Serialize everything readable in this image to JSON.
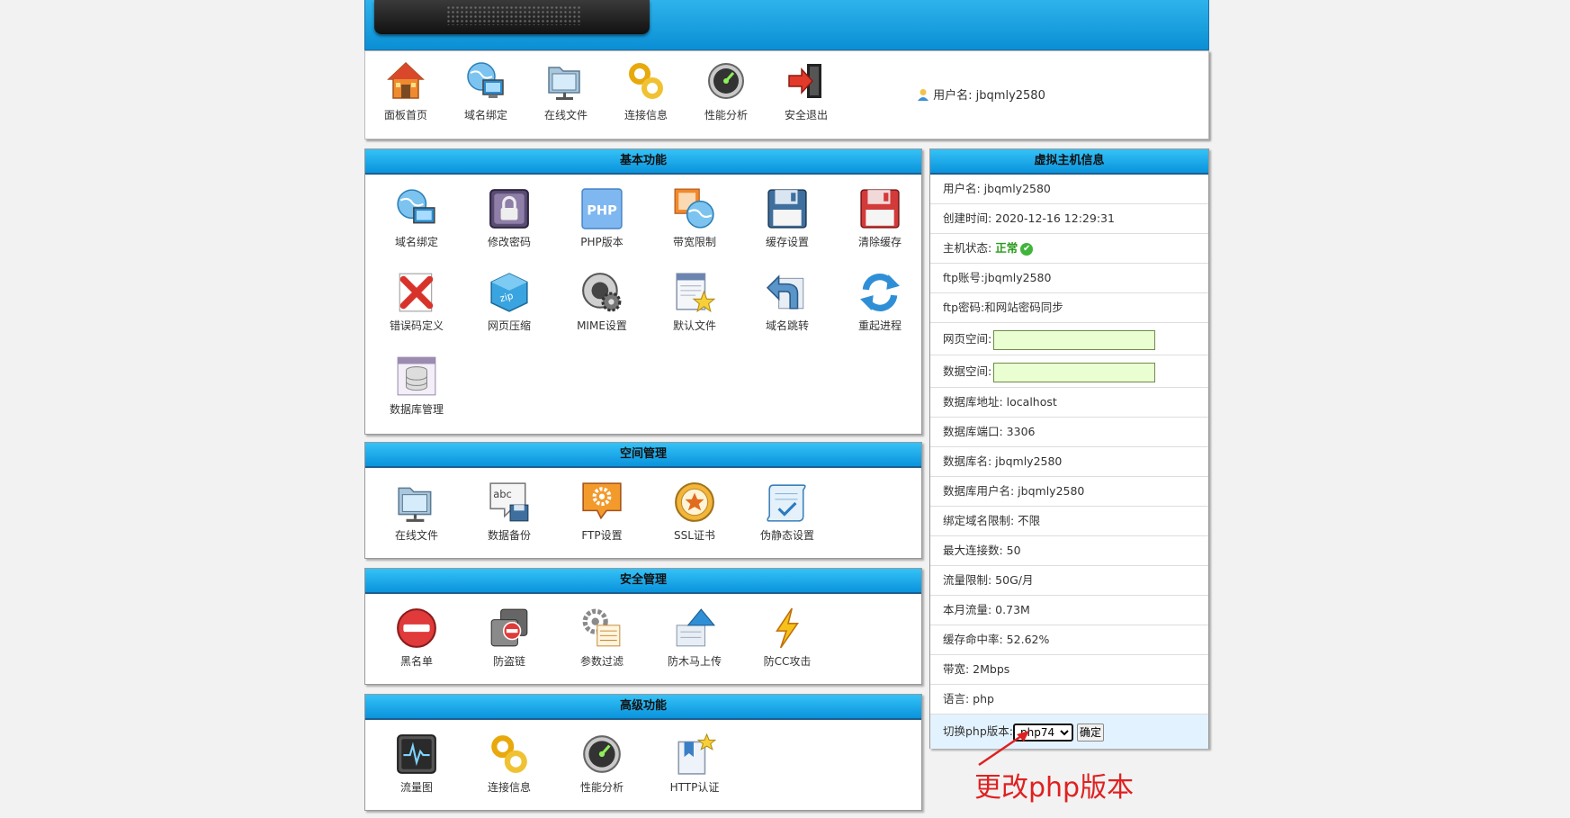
{
  "nav": {
    "items": [
      {
        "label": "面板首页",
        "icon": "home-icon"
      },
      {
        "label": "域名绑定",
        "icon": "globe-monitor-icon"
      },
      {
        "label": "在线文件",
        "icon": "folder-icon"
      },
      {
        "label": "连接信息",
        "icon": "chain-icon"
      },
      {
        "label": "性能分析",
        "icon": "gauge-icon"
      },
      {
        "label": "安全退出",
        "icon": "exit-door-icon"
      }
    ],
    "user_label": "用户名:",
    "username": "jbqmly2580"
  },
  "basic": {
    "title": "基本功能",
    "items": [
      {
        "label": "域名绑定",
        "icon": "globe-monitor-icon"
      },
      {
        "label": "修改密码",
        "icon": "lock-icon"
      },
      {
        "label": "PHP版本",
        "icon": "php-icon"
      },
      {
        "label": "带宽限制",
        "icon": "bandwidth-icon"
      },
      {
        "label": "缓存设置",
        "icon": "floppy-blue-icon"
      },
      {
        "label": "清除缓存",
        "icon": "floppy-red-icon"
      },
      {
        "label": "错误码定义",
        "icon": "error-x-icon"
      },
      {
        "label": "网页压缩",
        "icon": "zip-box-icon"
      },
      {
        "label": "MIME设置",
        "icon": "gear-disc-icon"
      },
      {
        "label": "默认文件",
        "icon": "document-star-icon"
      },
      {
        "label": "域名跳转",
        "icon": "redirect-arrow-icon"
      },
      {
        "label": "重起进程",
        "icon": "refresh-icon"
      },
      {
        "label": "数据库管理",
        "icon": "database-icon"
      }
    ]
  },
  "space": {
    "title": "空间管理",
    "items": [
      {
        "label": "在线文件",
        "icon": "folder-icon"
      },
      {
        "label": "数据备份",
        "icon": "backup-icon"
      },
      {
        "label": "FTP设置",
        "icon": "ftp-gear-icon"
      },
      {
        "label": "SSL证书",
        "icon": "certificate-icon"
      },
      {
        "label": "伪静态设置",
        "icon": "scroll-icon"
      }
    ]
  },
  "security": {
    "title": "安全管理",
    "items": [
      {
        "label": "黑名单",
        "icon": "no-entry-icon"
      },
      {
        "label": "防盗链",
        "icon": "anti-leech-icon"
      },
      {
        "label": "参数过滤",
        "icon": "filter-gear-icon"
      },
      {
        "label": "防木马上传",
        "icon": "upload-shield-icon"
      },
      {
        "label": "防CC攻击",
        "icon": "lightning-icon"
      }
    ]
  },
  "advanced": {
    "title": "高级功能",
    "items": [
      {
        "label": "流量图",
        "icon": "traffic-chart-icon"
      },
      {
        "label": "连接信息",
        "icon": "chain-icon"
      },
      {
        "label": "性能分析",
        "icon": "gauge-icon"
      },
      {
        "label": "HTTP认证",
        "icon": "bookmark-star-icon"
      }
    ]
  },
  "hostinfo": {
    "title": "虚拟主机信息",
    "rows": [
      "用户名: jbqmly2580",
      "创建时间: 2020-12-16 12:29:31"
    ],
    "status_label": "主机状态: ",
    "status_value": "正常",
    "rows2": [
      "ftp账号:jbqmly2580",
      "ftp密码:和网站密码同步"
    ],
    "web_space_label": "网页空间:",
    "db_space_label": "数据空间:",
    "rows3": [
      "数据库地址: localhost",
      "数据库端口: 3306",
      "数据库名: jbqmly2580",
      "数据库用户名: jbqmly2580",
      "绑定域名限制: 不限",
      "最大连接数: 50",
      "流量限制: 50G/月",
      "本月流量: 0.73M",
      "缓存命中率: 52.62%",
      "带宽: 2Mbps",
      "语言: php"
    ],
    "switch_label": "切换php版本:",
    "php_selected": "php74",
    "confirm_label": "确定"
  },
  "annotation": "更改php版本",
  "colors": {
    "header_blue": "#0a93dc",
    "status_green": "#2b9a1d",
    "annotation_red": "#e02020"
  }
}
